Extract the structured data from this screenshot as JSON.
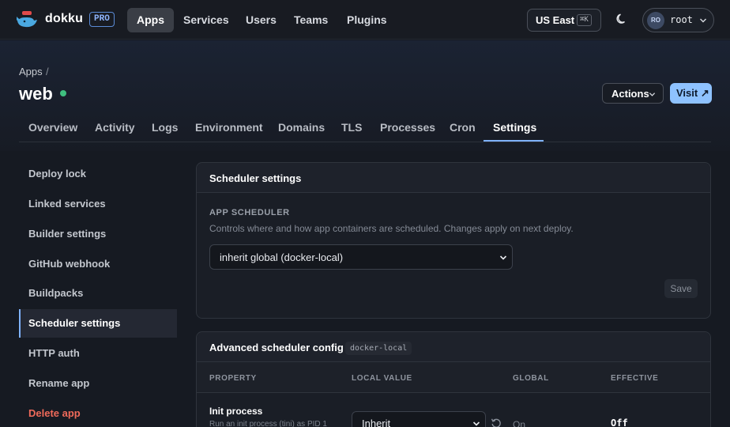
{
  "topbar": {
    "brand": "dokku",
    "pro_badge": "PRO",
    "nav": [
      "Apps",
      "Services",
      "Users",
      "Teams",
      "Plugins"
    ],
    "active_nav": "Apps",
    "region": "US East",
    "region_shortcut": "⌘K",
    "user_initials": "RO",
    "user_name": "root"
  },
  "header": {
    "breadcrumb": "Apps",
    "breadcrumb_sep": "/",
    "app_name": "web",
    "status_color": "#3fbf7f",
    "actions_label": "Actions",
    "visit_label": "Visit ↗"
  },
  "tabs": [
    "Overview",
    "Activity",
    "Logs",
    "Environment",
    "Domains",
    "TLS",
    "Processes",
    "Cron",
    "Settings"
  ],
  "active_tab": "Settings",
  "sidebar": {
    "items": [
      "Deploy lock",
      "Linked services",
      "Builder settings",
      "GitHub webhook",
      "Buildpacks",
      "Scheduler settings",
      "HTTP auth",
      "Rename app",
      "Delete app"
    ],
    "active": "Scheduler settings"
  },
  "scheduler_panel": {
    "title": "Scheduler settings",
    "field_label": "APP SCHEDULER",
    "help": "Controls where and how app containers are scheduled. Changes apply on next deploy.",
    "selected": "inherit global (docker-local)",
    "save_label": "Save"
  },
  "advanced_panel": {
    "title": "Advanced scheduler config",
    "badge": "docker-local",
    "columns": [
      "PROPERTY",
      "LOCAL VALUE",
      "GLOBAL",
      "EFFECTIVE"
    ],
    "rows": [
      {
        "name": "Init process",
        "description": "Run an init process (tini) as PID 1",
        "local_value": "Inherit",
        "global": "On",
        "effective": "Off"
      }
    ]
  },
  "colors": {
    "accent": "#7fb2ff",
    "visit_button": "#8ec2ff",
    "danger": "#ef6a5a",
    "background": "#161a22"
  }
}
